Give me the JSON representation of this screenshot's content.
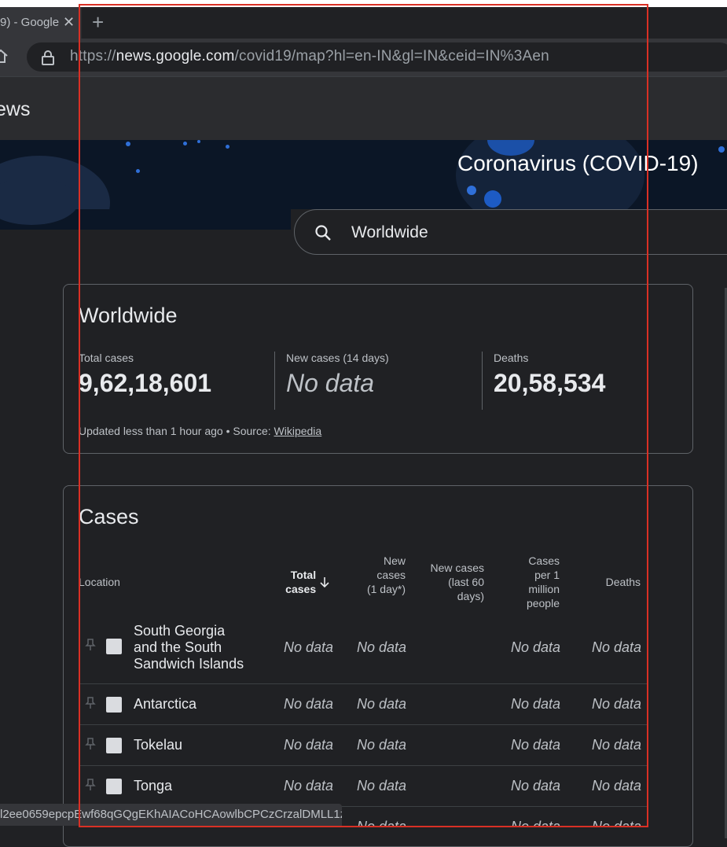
{
  "browser": {
    "tab_title": "9) - Google",
    "tab_close": "✕",
    "new_tab": "+",
    "url_scheme": "https://",
    "url_host": "news.google.com",
    "url_path": "/covid19/map?hl=en-IN&gl=IN&ceid=IN%3Aen"
  },
  "header": {
    "logo_text": "ews"
  },
  "hero": {
    "title": "Coronavirus (COVID-19)"
  },
  "search": {
    "value": "Worldwide",
    "icon": "search-icon"
  },
  "worldwide": {
    "title": "Worldwide",
    "stats": [
      {
        "label": "Total cases",
        "value": "9,62,18,601"
      },
      {
        "label": "New cases (14 days)",
        "value": "No data"
      },
      {
        "label": "Deaths",
        "value": "20,58,534"
      }
    ],
    "updated_prefix": "Updated less than 1 hour ago • Source: ",
    "source_link": "Wikipedia"
  },
  "cases": {
    "title": "Cases",
    "columns": {
      "location": "Location",
      "total_cases": "Total cases",
      "new_cases_1day": "New cases (1 day*)",
      "new_cases_60": "New cases (last 60 days)",
      "cases_per_million": "Cases per 1 million people",
      "deaths": "Deaths"
    },
    "rows": [
      {
        "location": "South Georgia and the South Sandwich Islands",
        "total": "No data",
        "new1": "No data",
        "per_million": "No data",
        "deaths": "No data"
      },
      {
        "location": "Antarctica",
        "total": "No data",
        "new1": "No data",
        "per_million": "No data",
        "deaths": "No data"
      },
      {
        "location": "Tokelau",
        "total": "No data",
        "new1": "No data",
        "per_million": "No data",
        "deaths": "No data"
      },
      {
        "location": "Tonga",
        "total": "No data",
        "new1": "No data",
        "per_million": "No data",
        "deaths": "No data"
      },
      {
        "location": "",
        "total": "",
        "new1": "No data",
        "per_million": "No data",
        "deaths": "No data"
      }
    ]
  },
  "status_bar": {
    "text": "l2ee0659epcpEwf68qGQgEKhAIACoHCAowlbCPCzCrzalDMLL1z..."
  },
  "colors": {
    "accent": "#2f6fd8",
    "highlight_frame": "#d93025",
    "background": "#202124"
  }
}
